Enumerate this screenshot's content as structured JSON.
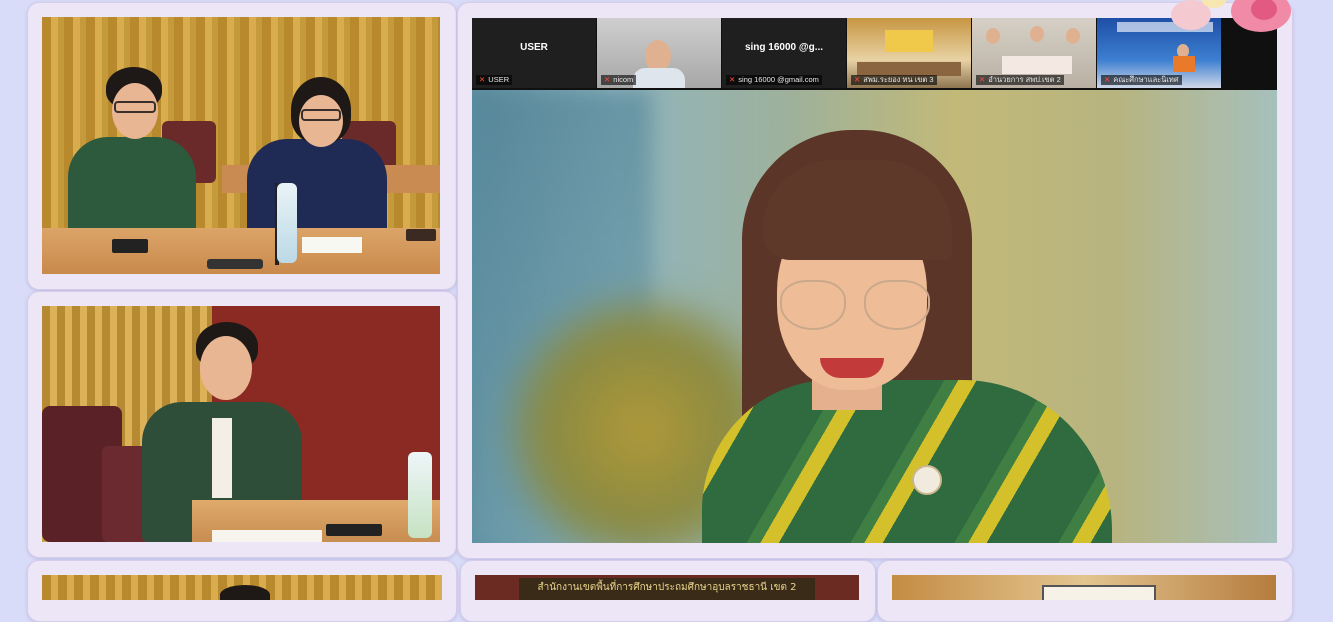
{
  "zoom": {
    "participants": [
      {
        "name": "USER",
        "label": "USER",
        "video": false
      },
      {
        "name": "",
        "label": "nicom",
        "video": true
      },
      {
        "name": "sing 16000 @g...",
        "label": "sing 16000 @gmail.com",
        "video": false
      },
      {
        "name": "",
        "label": "สพม.ระยอง ทน เขต 3",
        "video": true
      },
      {
        "name": "",
        "label": "อำนวยการ สพป.เขต 2",
        "video": true
      },
      {
        "name": "",
        "label": "คณะศึกษาและนิเทศ",
        "video": true
      }
    ]
  },
  "bottom": {
    "sign_text": "สำนักงานเขตพื้นที่การศึกษาประถมศึกษาอุบลราชธานี เขต 2"
  },
  "colors": {
    "background": "#d9dcf8",
    "card": "#ece6f7",
    "mic_muted": "#ff4a3c"
  }
}
